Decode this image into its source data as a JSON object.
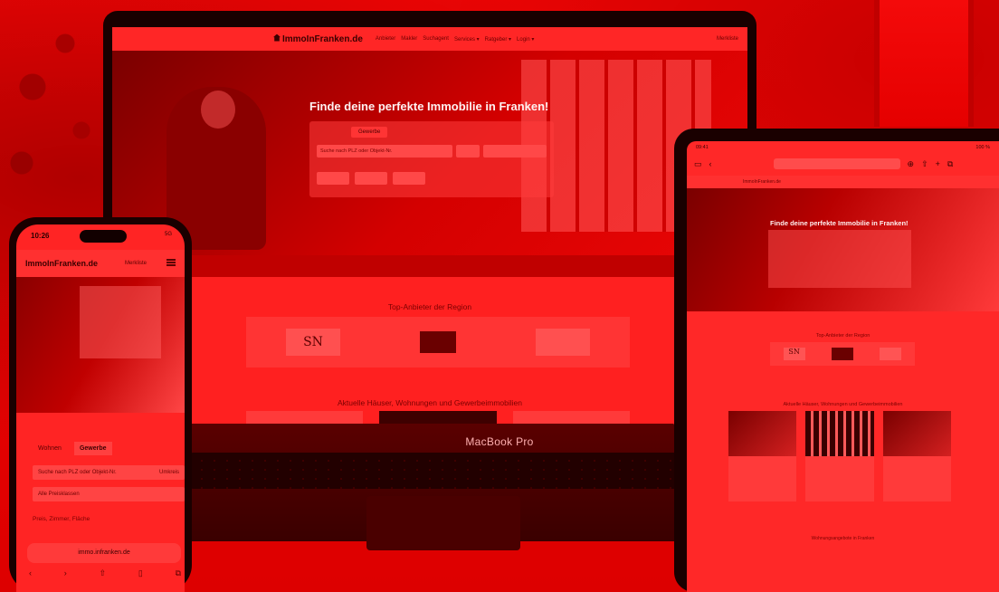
{
  "laptop": {
    "brand": "MacBook Pro",
    "site": {
      "logo": "ImmoInFranken.de",
      "nav": [
        "Anbieter",
        "Makler",
        "Suchagent",
        "Services ▾",
        "Ratgeber ▾",
        "Login ▾"
      ],
      "merkliste": "Merkliste",
      "hero_title": "Finde deine perfekte Immobilie in Franken!",
      "search_tab": "Gewerbe",
      "search_placeholder": "Suche nach PLZ oder Objekt-Nr.",
      "partners_title": "Top-Anbieter der Region",
      "partner_sn": "SN",
      "listings_title": "Aktuelle Häuser, Wohnungen und Gewerbeimmobilien"
    }
  },
  "phone": {
    "time": "10:26",
    "status_right": "5G",
    "logo": "ImmoInFranken.de",
    "merkliste": "Merkliste",
    "tabs": [
      "Wohnen",
      "Gewerbe"
    ],
    "search_placeholder": "Suche nach PLZ oder Objekt-Nr.",
    "radius": "Umkreis",
    "type_select": "Alle Preisklassen",
    "filter_text": "Preis, Zimmer, Fläche",
    "url": "immo.infranken.de",
    "toolbar_icons": [
      "chevron-left-icon",
      "chevron-right-icon",
      "share-icon",
      "book-icon",
      "tabs-icon"
    ]
  },
  "tablet": {
    "status_left": "09:41",
    "status_right": "100 %",
    "logo": "ImmoInFranken.de",
    "hero_title": "Finde deine perfekte Immobilie in Franken!",
    "partners_title": "Top-Anbieter der Region",
    "partner_sn": "SN",
    "listings_title": "Aktuelle Häuser, Wohnungen und Gewerbeimmobilien",
    "footer_title": "Wohnungsangebote in Franken"
  },
  "colors": {
    "tint": "#e30000",
    "device_frame": "#1a0000"
  }
}
